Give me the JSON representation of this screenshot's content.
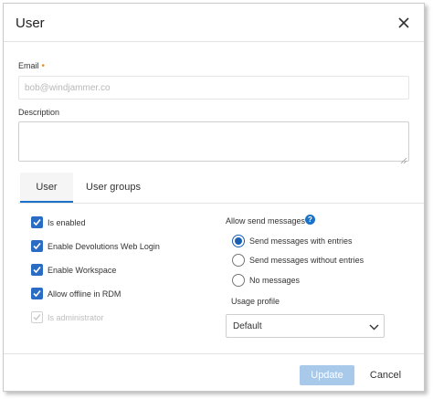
{
  "dialog": {
    "title": "User",
    "close_icon": "close-icon"
  },
  "form": {
    "email": {
      "label": "Email",
      "required_marker": "•",
      "value": "",
      "placeholder": "bob@windjammer.co"
    },
    "description": {
      "label": "Description",
      "value": ""
    }
  },
  "tabs": [
    {
      "label": "User",
      "active": true
    },
    {
      "label": "User groups",
      "active": false
    }
  ],
  "checkboxes": [
    {
      "label": "Is enabled",
      "checked": true,
      "disabled": false
    },
    {
      "label": "Enable Devolutions Web Login",
      "checked": true,
      "disabled": false
    },
    {
      "label": "Enable Workspace",
      "checked": true,
      "disabled": false
    },
    {
      "label": "Allow offline in RDM",
      "checked": true,
      "disabled": false
    },
    {
      "label": "Is administrator",
      "checked": true,
      "disabled": true
    }
  ],
  "messages": {
    "label": "Allow send messages",
    "help_glyph": "?",
    "options": [
      {
        "label": "Send messages with entries",
        "selected": true
      },
      {
        "label": "Send messages without entries",
        "selected": false
      },
      {
        "label": "No messages",
        "selected": false
      }
    ]
  },
  "usage_profile": {
    "label": "Usage profile",
    "value": "Default"
  },
  "footer": {
    "update_label": "Update",
    "cancel_label": "Cancel"
  },
  "colors": {
    "accent": "#1a73c8",
    "checkbox": "#2a6cc4",
    "required": "#f08a24",
    "update_disabled": "#a9c9ea"
  }
}
